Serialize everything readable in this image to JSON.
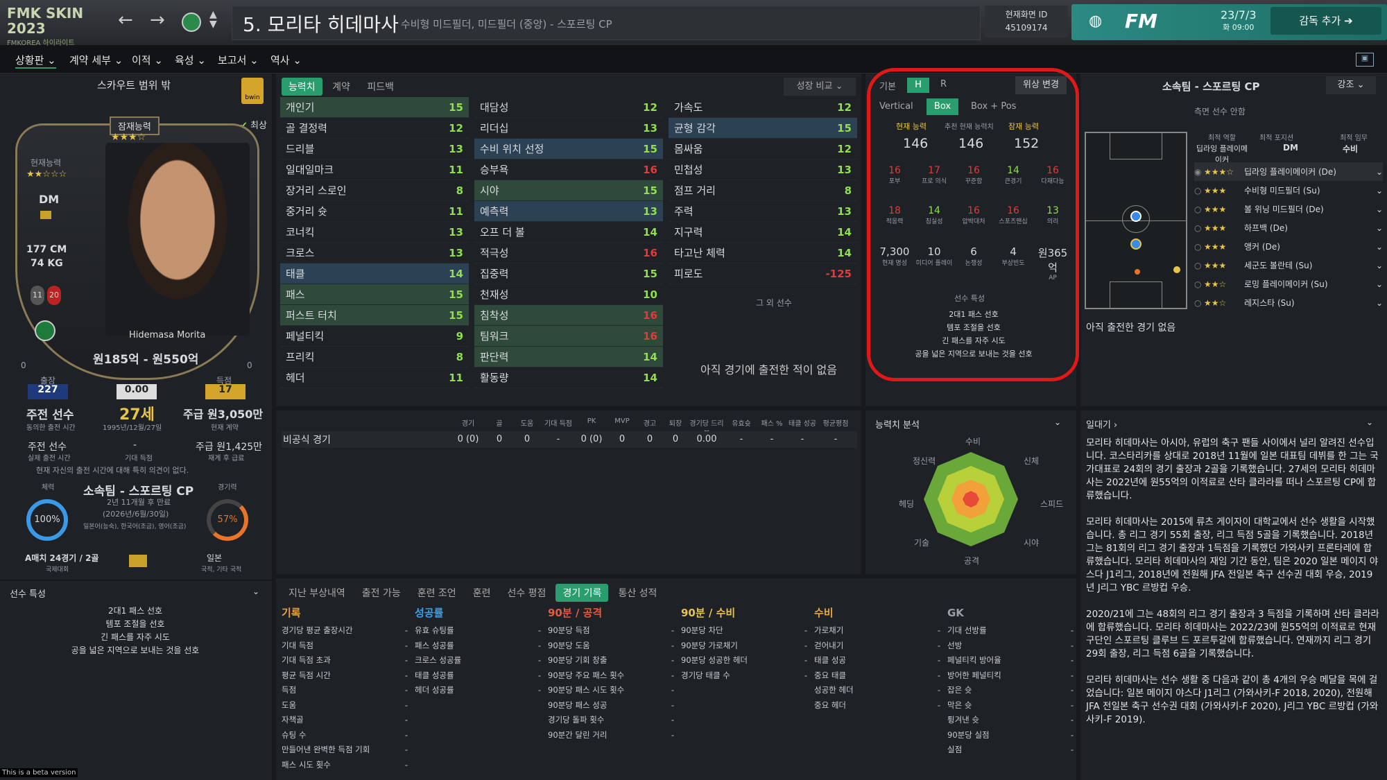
{
  "topbar": {
    "brand": "FMK SKIN 2023",
    "brand_sub": "FMKOREA 하이라이트",
    "player_title": "5. 모리타 히데마사",
    "player_positions": "수비형 미드필더, 미드필더 (중앙) - 스포르팅 CP",
    "id_label": "현재화면 ID",
    "id_value": "45109174",
    "fm_label": "FM",
    "date": "23/7/3",
    "time": "화 09:00",
    "add_manager": "감독 추가"
  },
  "menu": [
    "상황판",
    "계약 세부",
    "이적",
    "육성",
    "보고서",
    "역사"
  ],
  "left": {
    "scout_header": "스카우트 범위 밖",
    "potential_label": "잠재능력",
    "current_label": "현재능력",
    "position": "DM",
    "height": "177 CM",
    "weight": "74 KG",
    "badge1": "11",
    "badge2": "20",
    "best_label": "최상",
    "player_name_card": "Hidemasa Morita",
    "value_range": "원185억 - 원550억",
    "left_small": "0",
    "right_small": "0",
    "appearances_label": "출장",
    "appearances": "227",
    "rating": "0.00",
    "goals_label": "득점",
    "goals": "17",
    "role": "주전 선수",
    "role_sub": "동의한 출전 시간",
    "age": "27세",
    "dob": "1995년/12월/27일",
    "wage": "주급 원3,050만",
    "wage_sub": "현재 계약",
    "role2": "주전 선수",
    "role2_sub": "실제 출전 시간",
    "dash": "-",
    "dash_sub": "기대 득점",
    "wage2": "주급 원1,425만",
    "wage2_sub": "재계 후 급료",
    "complaint": "현재 자신의 출전 시간에 대해 특히 의견이 없다.",
    "fitness_label": "체력",
    "club": "소속팀 - 스포르팅 CP",
    "contract": "2년 11개월 후 만료",
    "contract_date": "(2026년/6월/30일)",
    "languages": "일본어(능숙), 한국어(조금), 영어(조금)",
    "exp_label": "경기력",
    "fitness_pct": "100%",
    "exp_pct": "57%",
    "intl": "A매치 24경기 / 2골",
    "intl_sub": "국제대회",
    "nation": "일본",
    "nation_sub": "국적, 기타 국적",
    "traits_title": "선수 특성",
    "traits": [
      "2대1 패스 선호",
      "템포 조절을 선호",
      "긴 패스를 자주 시도",
      "공을 넓은 지역으로 보내는 것을 선호"
    ]
  },
  "tabs": {
    "ability": "능력치",
    "contract": "계약",
    "feedback": "피드백",
    "growth": "성장 비교"
  },
  "attributes": {
    "col1": [
      [
        "개인기",
        "15"
      ],
      [
        "골 결정력",
        "12"
      ],
      [
        "드리블",
        "13"
      ],
      [
        "일대일마크",
        "11"
      ],
      [
        "장거리 스로인",
        "8"
      ],
      [
        "중거리 슛",
        "11"
      ],
      [
        "코너킥",
        "13"
      ],
      [
        "크로스",
        "13"
      ],
      [
        "태클",
        "14"
      ],
      [
        "패스",
        "15"
      ],
      [
        "퍼스트 터치",
        "15"
      ],
      [
        "페널티킥",
        "9"
      ],
      [
        "프리킥",
        "8"
      ],
      [
        "헤더",
        "11"
      ]
    ],
    "col2": [
      [
        "대담성",
        "12"
      ],
      [
        "리더십",
        "13"
      ],
      [
        "수비 위치 선정",
        "15"
      ],
      [
        "승부욕",
        "16"
      ],
      [
        "시야",
        "15"
      ],
      [
        "예측력",
        "13"
      ],
      [
        "오프 더 볼",
        "14"
      ],
      [
        "적극성",
        "16"
      ],
      [
        "집중력",
        "15"
      ],
      [
        "천재성",
        "10"
      ],
      [
        "침착성",
        "16"
      ],
      [
        "팀워크",
        "16"
      ],
      [
        "판단력",
        "14"
      ],
      [
        "활동량",
        "14"
      ]
    ],
    "col3": [
      [
        "가속도",
        "12"
      ],
      [
        "균형 감각",
        "15"
      ],
      [
        "몸싸움",
        "12"
      ],
      [
        "민첩성",
        "13"
      ],
      [
        "점프 거리",
        "8"
      ],
      [
        "주력",
        "13"
      ],
      [
        "지구력",
        "14"
      ],
      [
        "타고난 체력",
        "14"
      ],
      [
        "피로도",
        "-125"
      ]
    ],
    "other_label": "그 외 선수",
    "no_match": "아직 경기에 출전한 적이 없음"
  },
  "position_panel": {
    "tab_basic": "기본",
    "tab_h": "H",
    "tab_r": "R",
    "change_btn": "위상 변경",
    "vertical": "Vertical",
    "box": "Box",
    "boxpos": "Box + Pos",
    "ca_label": "현재 능력",
    "ca_value": "146",
    "rec_label": "추천 현재 능력치",
    "rec_value": "146",
    "pa_label": "잠재 능력",
    "pa_value": "152",
    "hidden1": [
      [
        "16",
        "포부",
        "r"
      ],
      [
        "17",
        "프로 의식",
        "r"
      ],
      [
        "16",
        "꾸준함",
        "r"
      ],
      [
        "14",
        "큰경기",
        "g"
      ],
      [
        "16",
        "다재다능",
        "r"
      ]
    ],
    "hidden2": [
      [
        "18",
        "적응력",
        "r"
      ],
      [
        "14",
        "침실성",
        "g"
      ],
      [
        "16",
        "압박대처",
        "r"
      ],
      [
        "16",
        "스포츠맨십",
        "r"
      ],
      [
        "13",
        "의리",
        "g"
      ]
    ],
    "misc": [
      [
        "7,300",
        "현재 명성"
      ],
      [
        "10",
        "미디어 플레이"
      ],
      [
        "6",
        "논쟁성"
      ],
      [
        "4",
        "부상빈도"
      ],
      [
        "원365억",
        "AP"
      ]
    ],
    "traits_title": "선수 특성",
    "traits": [
      "2대1 패스 선호",
      "템포 조절을 선호",
      "긴 패스를 자주 시도",
      "공을 넓은 지역으로 보내는 것을 선호"
    ]
  },
  "club_panel": {
    "title": "소속팀 - 스포르팅 CP",
    "emph": "강조",
    "note": "측면 선수 안함",
    "col1_label": "최적 역할",
    "col1_value": "딥라잉 플레이메이커",
    "col2_label": "최적 포지션",
    "col2_value": "DM",
    "col3_label": "최적 임무",
    "col3_value": "수비",
    "roles": [
      "딥라잉 플레이메이커 (De)",
      "수비형 미드필더 (Su)",
      "볼 위닝 미드필더 (De)",
      "하프백 (De)",
      "앵커 (De)",
      "세군도 볼란테 (Su)",
      "로밍 플레이메이커 (Su)",
      "레지스타 (Su)"
    ],
    "pitch_nums": [
      "1",
      "1",
      "1",
      "1",
      "1",
      "1",
      "5",
      "10",
      "20",
      "29"
    ],
    "no_match": "아직 출전한 경기 없음"
  },
  "stats_table": {
    "headers": [
      "경기",
      "골",
      "도움",
      "기대 득점",
      "PK",
      "MVP",
      "경고",
      "퇴장",
      "경기당 드리블",
      "유효슛",
      "패스 %",
      "태클 성공",
      "평균평점"
    ],
    "row_label": "비공식 경기",
    "row": [
      "0 (0)",
      "0",
      "0",
      "-",
      "0 (0)",
      "0",
      "0",
      "0",
      "0.00",
      "-",
      "-",
      "-",
      "-"
    ]
  },
  "analysis": {
    "title": "능력치 분석",
    "axes": [
      "수비",
      "신체",
      "스피드",
      "시야",
      "공격",
      "기술",
      "헤딩",
      "정신력"
    ]
  },
  "bio": {
    "title": "일대기",
    "p1": "모리타 히데마사는 아시아, 유럽의 축구 팬들 사이에서 널리 알려진 선수입니다. 코스타리카를 상대로 2018년 11월에 일본 대표팀 데뷔를 한 그는 국가대표로 24회의 경기 출장과 2골을 기록했습니다. 27세의 모리타 히데마사는 2022년에 원55억의 이적료로 산타 클라라를 떠나 스포르팅 CP에 합류했습니다.",
    "p2": "모리타 히데마사는 2015에 류츠 게이자이 대학교에서 선수 생활을 시작했습니다. 총 리그 경기 55회 출장, 리그 득점 5골을 기록했습니다. 2018년 그는 81회의 리그 경기 출장과 1득점을 기록했던 가와사키 프론타레에 합류했습니다. 모리타 히데마사의 재임 기간 동안, 팀은 2020 일본 메이지 야스다 J1리그, 2018년에 전원해 JFA 전일본 축구 선수권 대회 우승, 2019년 J리그 YBC 르방컵 우승.",
    "p3": "2020/21에 그는 48회의 리그 경기 출장과 3 득점을 기록하며 산타 클라라에 합류했습니다. 모리타 히데마사는 2022/23에 원55억의 이적료로 현재 구단인 스포르팅 클루브 드 포르투갈에 합류했습니다. 연재까지 리그 경기 29회 출장, 리그 득점 6골을 기록했습니다.",
    "p4": "모리타 히데마사는 선수 생활 중 다음과 같이 총 4개의 우승 메달을 목에 걸었습니다: 일본 메이지 야스다 J1리그 (가와사키-F 2018, 2020), 전원해 JFA 전일본 축구 선수권 대회 (가와사키-F 2020), J리그 YBC 르방컵 (가와사키-F 2019)."
  },
  "bottom_tabs": [
    "지난 부상내역",
    "출전 가능",
    "훈련 조언",
    "훈련",
    "선수 평점",
    "경기 기록",
    "통산 성적"
  ],
  "bottom_cols": [
    {
      "title": "기록",
      "color": "#e8a53a",
      "items": [
        "경기당 평균 출장시간",
        "기대 득점",
        "기대 득점 초과",
        "평균 득점 시간",
        "득점",
        "도움",
        "자책골",
        "슈팅 수",
        "만들어낸 완벽한 득점 기회",
        "패스 시도 횟수"
      ]
    },
    {
      "title": "성공률",
      "color": "#3aa0e8",
      "items": [
        "유효 슈팅률",
        "패스 성공률",
        "크로스 성공률",
        "태클 성공률",
        "헤더 성공률"
      ]
    },
    {
      "title": "90분 / 공격",
      "color": "#e85a3a",
      "items": [
        "90분당 득점",
        "90분당 도움",
        "90분당 기회 창출",
        "90분당 주요 패스 횟수",
        "",
        "90분당 패스 시도 횟수",
        "90분당 패스 성공",
        "경기당 돌파 횟수",
        "90분간 달린 거리"
      ]
    },
    {
      "title": "90분 / 수비",
      "color": "#e8c547",
      "items": [
        "90분당 차단",
        "90분당 가로채기",
        "90분당 성공한 헤더",
        "경기당 태클 수"
      ]
    },
    {
      "title": "수비",
      "color": "#e8a53a",
      "items": [
        "가로채기",
        "걷어내기",
        "태클 성공",
        "중요 태클",
        "성공한 헤더",
        "중요 헤더"
      ]
    },
    {
      "title": "GK",
      "color": "#9aa0a8",
      "items": [
        "기대 선방률",
        "선방",
        "페널티킥 방어율",
        "방어한 페널티킥",
        "잡은 슛",
        "막은 슛",
        "튕겨낸 슛",
        "90분당 실점",
        "실점"
      ]
    }
  ],
  "beta": "This is a beta version"
}
